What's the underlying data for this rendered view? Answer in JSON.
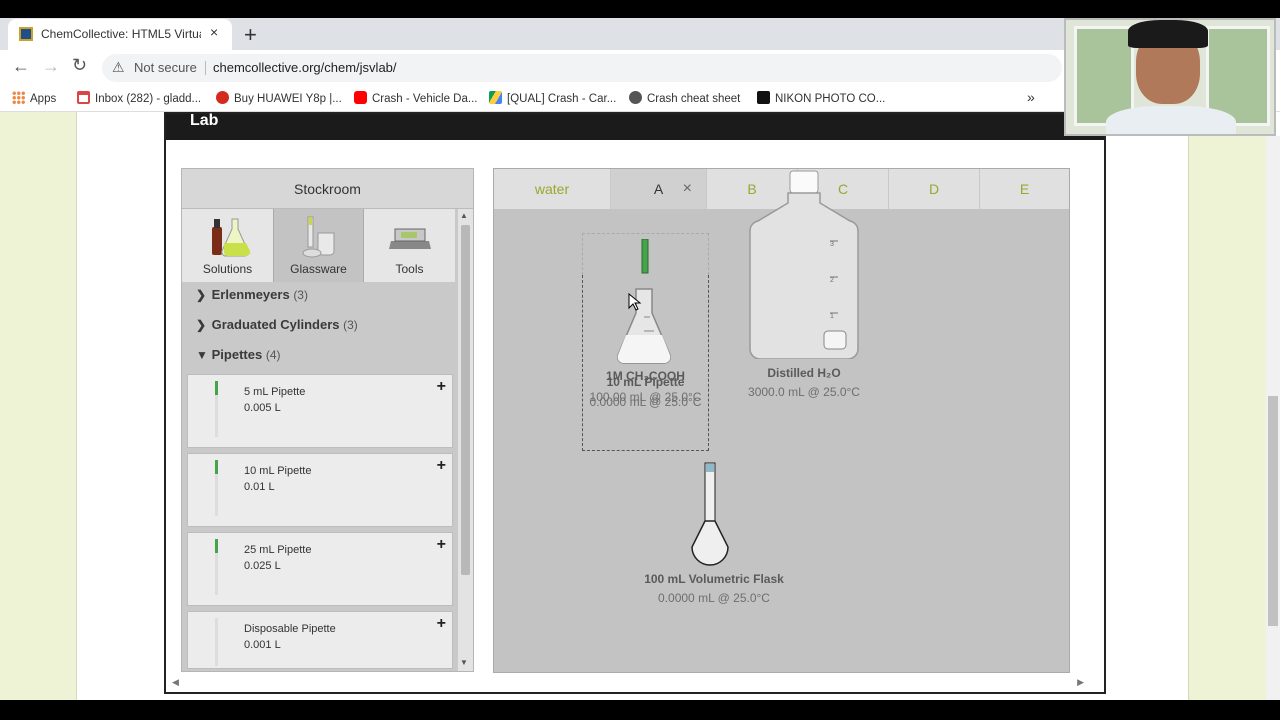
{
  "browser": {
    "tab_title": "ChemCollective: HTML5 Virtual L",
    "tab_close": "×",
    "new_tab": "+",
    "not_secure": "Not secure",
    "url": "chemcollective.org/chem/jsvlab/",
    "bookmarks": [
      "Apps",
      "Inbox (282) - gladd...",
      "Buy HUAWEI Y8p |...",
      "Crash - Vehicle Da...",
      "[QUAL] Crash - Car...",
      "Crash cheat sheet",
      "NIKON PHOTO CO..."
    ],
    "bookmarks_more": "»"
  },
  "lab": {
    "logo": "Lab"
  },
  "stockroom": {
    "title": "Stockroom",
    "tabs": [
      "Solutions",
      "Glassware",
      "Tools"
    ],
    "categories": [
      {
        "name": "Erlenmeyers",
        "count": "(3)",
        "chev": ">"
      },
      {
        "name": "Graduated Cylinders",
        "count": "(3)",
        "chev": ">"
      },
      {
        "name": "Pipettes",
        "count": "(4)",
        "chev": "v"
      }
    ],
    "items": [
      {
        "name": "5 mL Pipette",
        "vol": "0.005 L",
        "plus": "+"
      },
      {
        "name": "10 mL Pipette",
        "vol": "0.01 L",
        "plus": "+"
      },
      {
        "name": "25 mL Pipette",
        "vol": "0.025 L",
        "plus": "+"
      },
      {
        "name": "Disposable Pipette",
        "vol": "0.001 L",
        "plus": "+"
      }
    ]
  },
  "workbench": {
    "tabs": [
      "water",
      "A",
      "B",
      "C",
      "D",
      "E"
    ],
    "tab_close": "×",
    "flask_label": "1M CH₃COOH",
    "flask_detail": "100.00 mL @ 25.0°C",
    "pipette_label": "10 mL Pipette",
    "pipette_detail": "0.0000 mL @ 25.0°C",
    "carboy_label": "Distilled H₂O",
    "carboy_detail": "3000.0 mL @ 25.0°C",
    "vflask_label": "100 mL Volumetric Flask",
    "vflask_detail": "0.0000 mL @ 25.0°C",
    "carboy_scale": [
      "3",
      "2",
      "1"
    ]
  },
  "colors": {
    "tab_accent": "#9aa72f",
    "side_green": "#eff3d6",
    "pipette_green": "#46a34a"
  }
}
